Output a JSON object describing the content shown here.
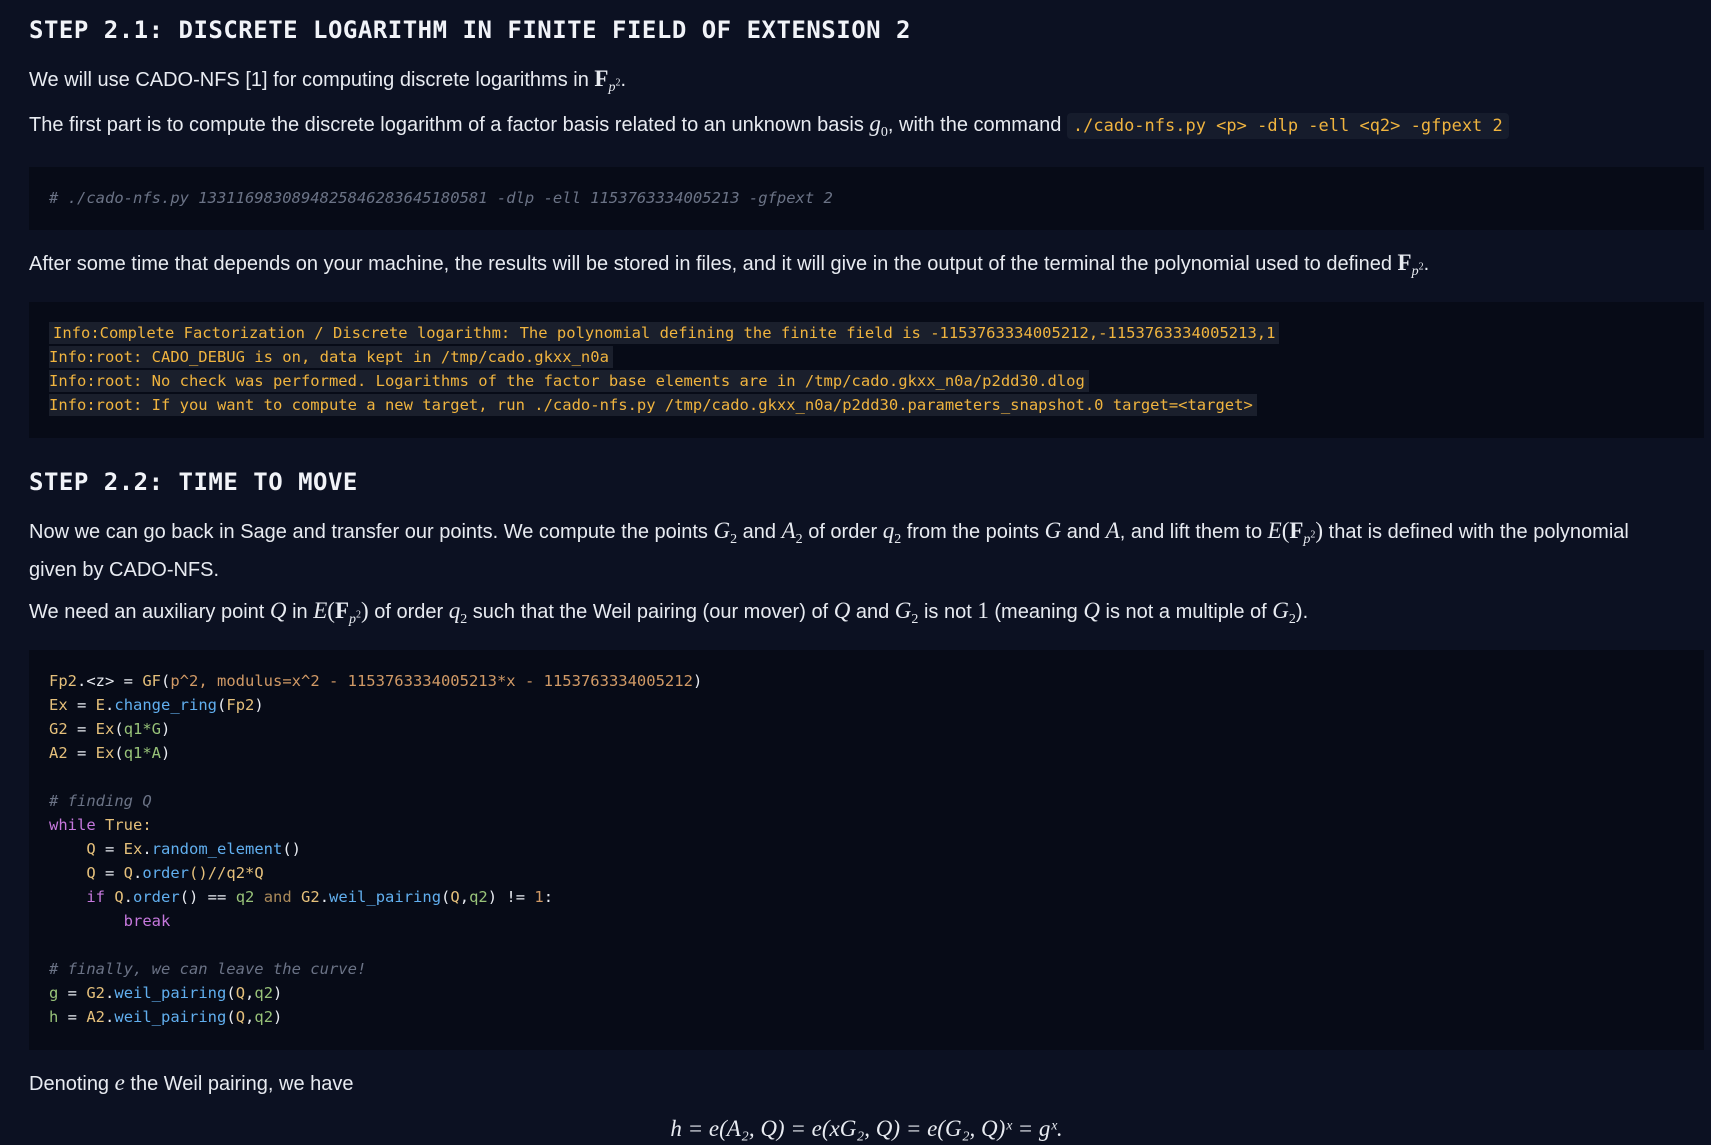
{
  "step1": {
    "heading": "STEP 2.1: DISCRETE LOGARITHM IN FINITE FIELD OF EXTENSION 2",
    "p1_text": "We will use CADO-NFS [1] for computing discrete logarithms in ",
    "p2_text_a": "The first part is to compute the discrete logarithm of a factor basis related to an unknown basis ",
    "p2_text_b": ", with the command ",
    "p2_code": "./cado-nfs.py <p> -dlp -ell <q2> -gfpext 2",
    "cmd_comment": "# ./cado-nfs.py 1331169830894825846283645180581 -dlp -ell 1153763334005213 -gfpext 2",
    "p3_text": "After some time that depends on your machine, the results will be stored in files, and it will give in the output of the terminal the polynomial used to defined ",
    "output_lines": [
      "Info:Complete Factorization / Discrete logarithm: The polynomial defining the finite field is -1153763334005212,-1153763334005213,1",
      "Info:root: CADO_DEBUG is on, data kept in /tmp/cado.gkxx_n0a",
      "Info:root: No check was performed. Logarithms of the factor base elements are in /tmp/cado.gkxx_n0a/p2dd30.dlog",
      "Info:root: If you want to compute a new target, run ./cado-nfs.py /tmp/cado.gkxx_n0a/p2dd30.parameters_snapshot.0 target=<target>"
    ]
  },
  "step2": {
    "heading": "STEP 2.2: TIME TO MOVE",
    "p1_a": "Now we can go back in Sage and transfer our points. We compute the points ",
    "p1_b": " and ",
    "p1_c": " of order ",
    "p1_d": " from the points ",
    "p1_e": " and ",
    "p1_f": ", and lift them to ",
    "p1_g": " that is defined with the polynomial",
    "p1_h": "given by CADO-NFS.",
    "p2_a": "We need an auxiliary point ",
    "p2_b": " in ",
    "p2_c": " of order ",
    "p2_d": " such that the Weil pairing (our mover) of ",
    "p2_e": " and ",
    "p2_f": " is not ",
    "p2_g": " (meaning ",
    "p2_h": " is not a multiple of ",
    "p2_i": ").",
    "code": {
      "l1": [
        "Fp2",
        ".<z> = ",
        "GF",
        "(",
        "p^2, modulus=x^2 - 1153763334005213*x - 1153763334005212",
        ")"
      ],
      "l2": [
        "Ex",
        " = ",
        "E",
        ".",
        "change_ring",
        "(",
        "Fp2",
        ")"
      ],
      "l3": [
        "G2",
        " = ",
        "Ex",
        "(",
        "q1*G",
        ")"
      ],
      "l4": [
        "A2",
        " = ",
        "Ex",
        "(",
        "q1*A",
        ")"
      ],
      "c1": "# finding Q",
      "l5": [
        "while",
        " True:"
      ],
      "l6": [
        "Q",
        " = ",
        "Ex",
        ".",
        "random_element",
        "()"
      ],
      "l7": [
        "Q",
        " = ",
        "Q",
        ".",
        "order",
        "()//q2*Q"
      ],
      "l8": [
        "if",
        " Q",
        ".",
        "order",
        "() == ",
        "q2",
        " and ",
        "G2",
        ".",
        "weil_pairing",
        "(",
        "Q",
        ",",
        "q2",
        ") != ",
        "1",
        ":"
      ],
      "l9": "break",
      "c2": "# finally, we can leave the curve!",
      "l10": [
        "g",
        " = ",
        "G2",
        ".",
        "weil_pairing",
        "(",
        "Q",
        ",",
        "q2",
        ")"
      ],
      "l11": [
        "h",
        " = ",
        "A2",
        ".",
        "weil_pairing",
        "(",
        "Q",
        ",",
        "q2",
        ")"
      ]
    },
    "p3_a": "Denoting ",
    "p3_b": " the Weil pairing, we have",
    "equation": "h = e(A₂, Q) = e(xG₂, Q) = e(G₂, Q)ˣ = gˣ."
  }
}
